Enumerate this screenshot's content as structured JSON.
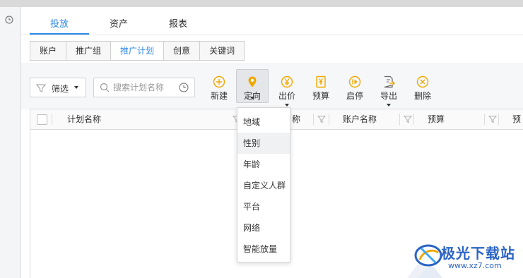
{
  "top_tabs": [
    "投放",
    "资产",
    "报表"
  ],
  "sub_tabs": [
    "账户",
    "推广组",
    "推广计划",
    "创意",
    "关键词"
  ],
  "filter": {
    "label": "筛选"
  },
  "search": {
    "placeholder": "搜索计划名称"
  },
  "toolbar": [
    {
      "label": "新建",
      "icon": "plus-circle-icon"
    },
    {
      "label": "定向",
      "icon": "location-pin-icon"
    },
    {
      "label": "出价",
      "icon": "yen-circle-icon"
    },
    {
      "label": "预算",
      "icon": "yen-document-icon"
    },
    {
      "label": "启停",
      "icon": "play-pause-icon"
    },
    {
      "label": "导出",
      "icon": "export-doc-icon"
    },
    {
      "label": "删除",
      "icon": "delete-circle-icon"
    }
  ],
  "table": {
    "columns": [
      "计划名称",
      "称",
      "账户名称",
      "预算",
      "预"
    ]
  },
  "targeting_menu": [
    "地域",
    "性别",
    "年龄",
    "自定义人群",
    "平台",
    "网络",
    "智能放量"
  ],
  "watermark": {
    "brand": "极光下载站",
    "url": "www.xz7.com"
  },
  "colors": {
    "accent": "#2f88e6",
    "toolbar_icon": "#f0a800",
    "watermark": "#2b64c4"
  }
}
